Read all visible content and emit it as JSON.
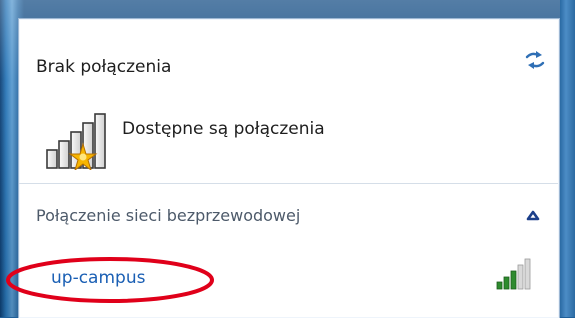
{
  "status": {
    "title": "Brak połączenia",
    "available": "Dostępne są połączenia"
  },
  "section": {
    "label": "Połączenie sieci bezprzewodowej"
  },
  "networks": [
    {
      "name": "up-campus",
      "signal_bars_filled": 3,
      "signal_bars_total": 5
    }
  ],
  "colors": {
    "network_link": "#1a5fb4",
    "annotation": "#e0001a",
    "panel_bg": "#ffffff"
  },
  "icons": {
    "refresh": "refresh-icon",
    "collapse": "chevron-up-icon",
    "signal": "wifi-signal-icon",
    "warning_star": "star-warning-icon"
  }
}
